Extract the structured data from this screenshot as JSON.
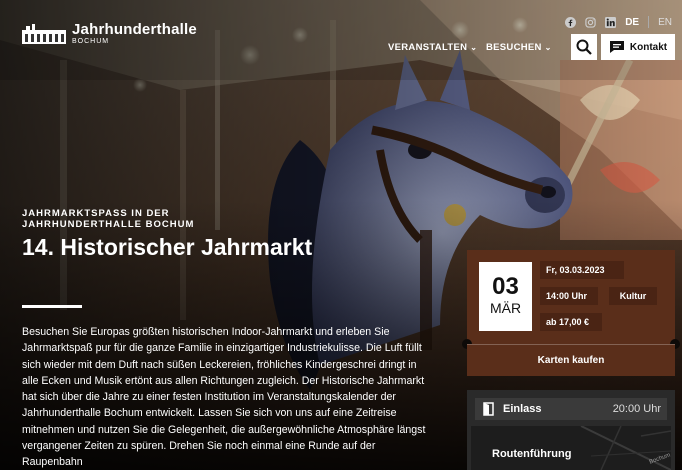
{
  "header": {
    "logo_name": "Jahrhunderthalle",
    "logo_city": "BOCHUM",
    "languages": [
      "DE",
      "EN"
    ],
    "nav": [
      "VERANSTALTEN",
      "BESUCHEN"
    ],
    "contact_label": "Kontakt"
  },
  "hero": {
    "eyebrow": "JAHRMARKTSPASS IN DER JAHRHUNDERTHALLE BOCHUM",
    "title": "14. Historischer Jahrmarkt",
    "description": "Besuchen Sie Europas größten historischen Indoor-Jahrmarkt und erleben Sie Jahrmarktspaß pur für die ganze Familie in einzigartiger Industriekulisse. Die Luft füllt sich wieder mit dem Duft nach süßen Leckereien, fröhliches Kindergeschrei dringt in alle Ecken und Musik ertönt aus allen Richtungen zugleich. Der Historische Jahrmarkt hat sich über die Jahre zu einer festen Institution im Veranstaltungskalender der Jahrhunderthalle Bochum entwickelt. Lassen Sie sich von uns auf eine Zeitreise mitnehmen und nutzen Sie die Gelegenheit, die außergewöhnliche Atmosphäre längst vergangener Zeiten zu spüren. Drehen Sie noch einmal eine Runde auf der Raupenbahn"
  },
  "event": {
    "day": "03",
    "month": "MÄR",
    "date": "Fr, 03.03.2023",
    "time": "14:00 Uhr",
    "category": "Kultur",
    "price": "ab 17,00 €",
    "tickets_label": "Karten kaufen"
  },
  "info": {
    "entry_label": "Einlass",
    "entry_time": "20:00 Uhr",
    "route_label": "Routenführung",
    "map_text": "Bochum"
  },
  "colors": {
    "card_bg": "#5a2e1a",
    "chip_bg": "#4a2414",
    "info_bg": "#2a2a2a"
  }
}
